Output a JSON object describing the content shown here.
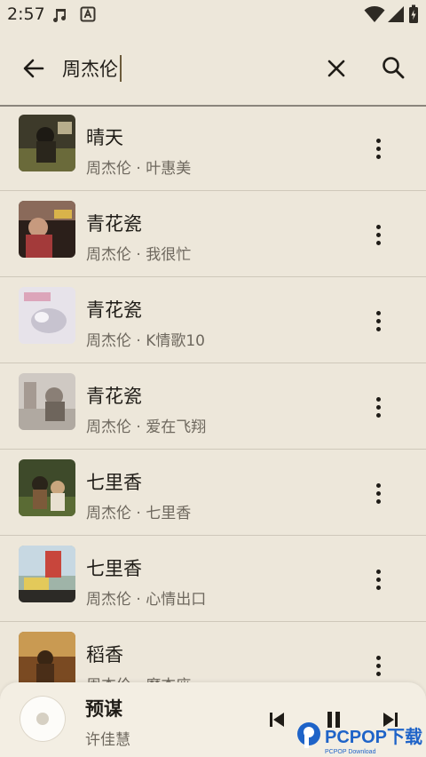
{
  "status_bar": {
    "time": "2:57",
    "icons": [
      "music-note-icon",
      "a-box-icon",
      "wifi-icon",
      "signal-icon",
      "battery-icon"
    ]
  },
  "search": {
    "query": "周杰伦",
    "back_icon": "arrow-left-icon",
    "clear_icon": "close-icon",
    "search_icon": "search-icon"
  },
  "results": [
    {
      "title": "晴天",
      "subtitle": "周杰伦 · 叶惠美"
    },
    {
      "title": "青花瓷",
      "subtitle": "周杰伦 · 我很忙"
    },
    {
      "title": "青花瓷",
      "subtitle": "周杰伦 · K情歌10"
    },
    {
      "title": "青花瓷",
      "subtitle": "周杰伦 · 爱在飞翔"
    },
    {
      "title": "七里香",
      "subtitle": "周杰伦 · 七里香"
    },
    {
      "title": "七里香",
      "subtitle": "周杰伦 · 心情出口"
    },
    {
      "title": "稻香",
      "subtitle": "周杰伦 · 魔杰座"
    }
  ],
  "now_playing": {
    "title": "预谋",
    "artist": "许佳慧",
    "controls": [
      "skip-previous-icon",
      "pause-icon",
      "skip-next-icon"
    ]
  },
  "watermark": {
    "text": "PCPOP下载",
    "sub": "PCPOP Download"
  },
  "colors": {
    "background": "#EDE7DA",
    "player_bg": "#F3EEE3",
    "divider": "#CFC8BA",
    "text_primary": "#1F1C17",
    "text_secondary": "#6E685E",
    "caret": "#6B5A3A",
    "watermark_blue": "#1E63C8"
  }
}
